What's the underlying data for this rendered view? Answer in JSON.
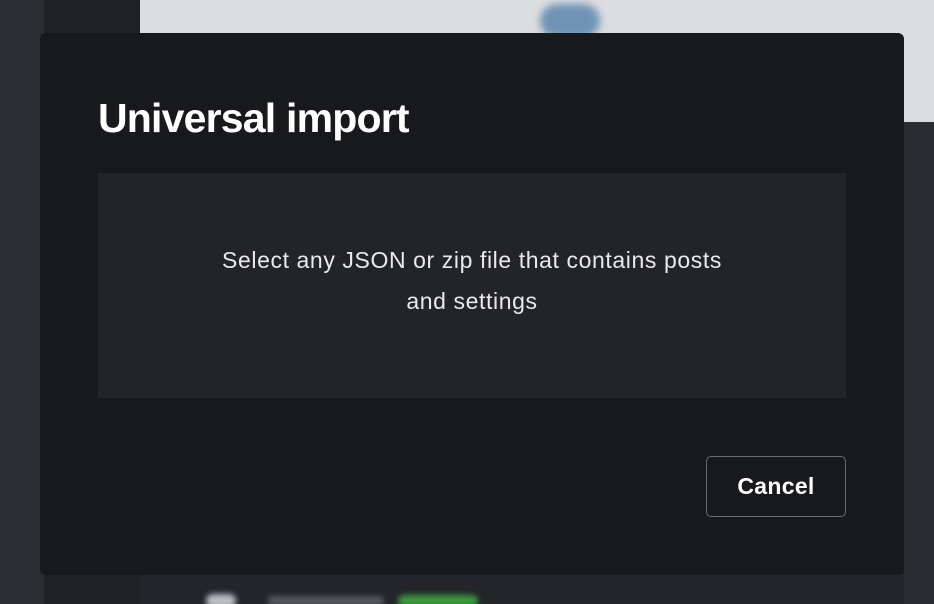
{
  "modal": {
    "title": "Universal import",
    "dropzone_text": "Select any JSON or zip file that contains posts and settings",
    "cancel_label": "Cancel"
  },
  "colors": {
    "modal_background": "#18191c",
    "dropzone_background": "#232428",
    "text_primary": "#ffffff",
    "button_border": "#6a6c72"
  }
}
